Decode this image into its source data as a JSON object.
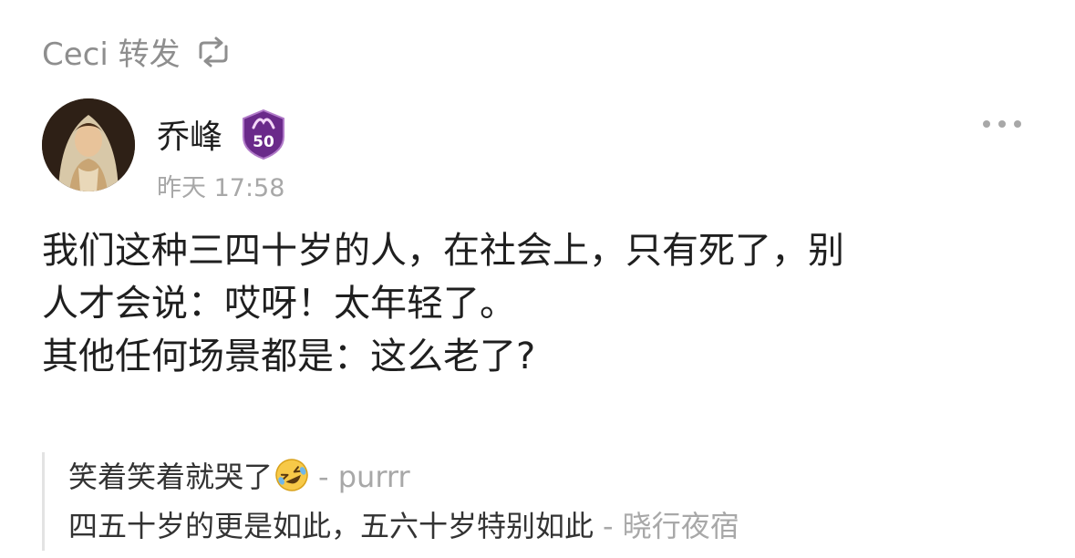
{
  "repost": {
    "label": "Ceci 转发",
    "icon": "repost-icon"
  },
  "post": {
    "author": {
      "name": "乔峰",
      "badge_level": "50"
    },
    "timestamp": "昨天 17:58",
    "body": [
      "我们这种三四十岁的人，在社会上，只有死了，别",
      "人才会说：哎呀！太年轻了。",
      "其他任何场景都是：这么老了?"
    ]
  },
  "comments": [
    {
      "text": "笑着笑着就哭了",
      "emoji": "rolling-laughing-emoji",
      "author": "- purrr"
    },
    {
      "text": "四五十岁的更是如此，五六十岁特别如此",
      "author": "- 晓行夜宿"
    }
  ],
  "colors": {
    "muted": "#a8a8a8",
    "badge": "#6a2a8a",
    "text": "#1f1f1f"
  }
}
